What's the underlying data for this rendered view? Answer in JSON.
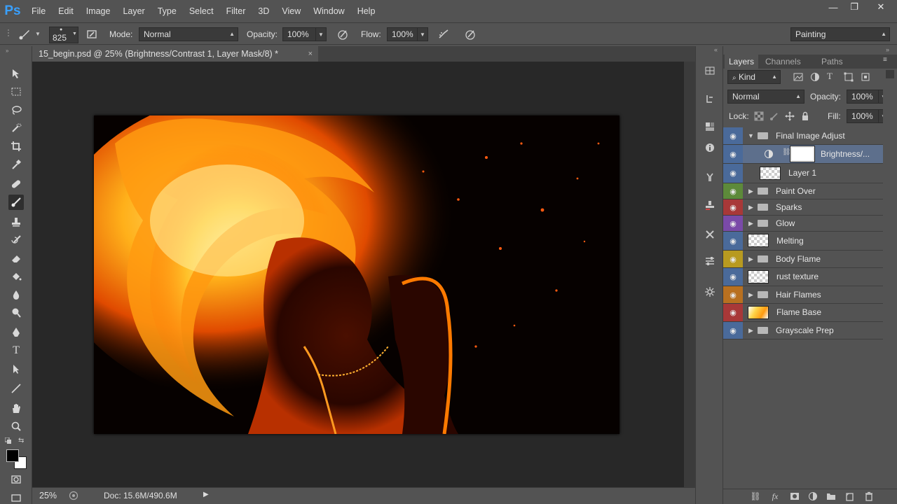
{
  "app": {
    "logo": "Ps"
  },
  "menu": [
    "File",
    "Edit",
    "Image",
    "Layer",
    "Type",
    "Select",
    "Filter",
    "3D",
    "View",
    "Window",
    "Help"
  ],
  "window_controls": {
    "minimize": "—",
    "maximize": "❐",
    "close": "✕"
  },
  "options": {
    "brush_size": "825",
    "mode_label": "Mode:",
    "mode_value": "Normal",
    "opacity_label": "Opacity:",
    "opacity_value": "100%",
    "flow_label": "Flow:",
    "flow_value": "100%",
    "workspace": "Painting"
  },
  "document": {
    "tab_title": "15_begin.psd @ 25% (Brightness/Contrast 1, Layer Mask/8) *",
    "tab_close": "×"
  },
  "status": {
    "zoom": "25%",
    "doc_info": "Doc: 15.6M/490.6M"
  },
  "layers_panel": {
    "tabs": [
      "Layers",
      "Channels",
      "Paths"
    ],
    "filter_kind": "Kind",
    "blend_mode": "Normal",
    "opacity_label": "Opacity:",
    "opacity_value": "100%",
    "lock_label": "Lock:",
    "fill_label": "Fill:",
    "fill_value": "100%",
    "layers": [
      {
        "name": "Final Image Adjust",
        "kind": "group",
        "expanded": true,
        "color": "#4a6a9a"
      },
      {
        "name": "Brightness/...",
        "kind": "adjustment",
        "selected": true,
        "color": "#4a6a9a"
      },
      {
        "name": "Layer 1",
        "kind": "pixel",
        "color": "#4a6a9a"
      },
      {
        "name": "Paint Over",
        "kind": "group",
        "color": "#5d8a3a"
      },
      {
        "name": "Sparks",
        "kind": "group",
        "color": "#a83838"
      },
      {
        "name": "Glow",
        "kind": "group",
        "color": "#7a4aa8"
      },
      {
        "name": "Melting",
        "kind": "pixel",
        "color": "#4a6a9a"
      },
      {
        "name": "Body Flame",
        "kind": "group",
        "color": "#b89a20"
      },
      {
        "name": "rust texture",
        "kind": "pixel",
        "color": "#4a6a9a"
      },
      {
        "name": "Hair Flames",
        "kind": "group",
        "color": "#b87020"
      },
      {
        "name": "Flame Base",
        "kind": "pixel-fire",
        "color": "#a83838"
      },
      {
        "name": "Grayscale Prep",
        "kind": "group",
        "color": "#4a6a9a"
      }
    ]
  }
}
